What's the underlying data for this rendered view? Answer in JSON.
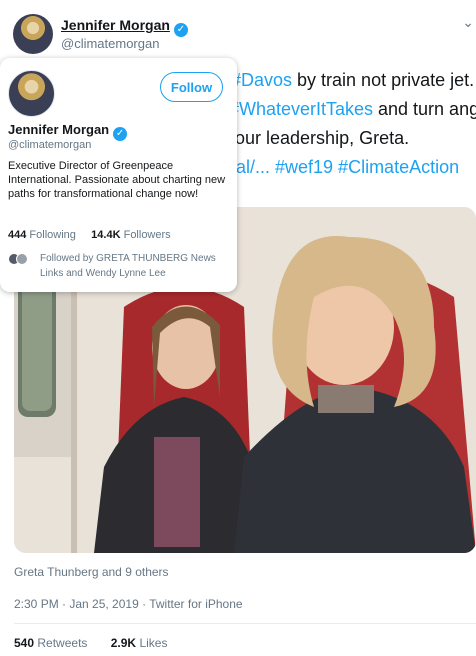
{
  "tweet": {
    "author_name": "Jennifer Morgan",
    "author_handle": "@climatemorgan",
    "text_lines": [
      [
        "",
        "#Davos",
        " by train not private jet."
      ],
      [
        "",
        "#WhateverItTakes",
        " and turn anger"
      ],
      [
        "our leadership, Greta.",
        "",
        ""
      ],
      [
        "",
        "al/... #wef19 #ClimateAction",
        ""
      ]
    ],
    "photo_tagged": "Greta Thunberg and 9 others",
    "timestamp": "2:30 PM · Jan 25, 2019 · Twitter for iPhone",
    "retweets_count": "540",
    "retweets_label": "Retweets",
    "likes_count": "2.9K",
    "likes_label": "Likes"
  },
  "hovercard": {
    "follow_label": "Follow",
    "name": "Jennifer Morgan",
    "handle": "@climatemorgan",
    "bio": "Executive Director of Greenpeace International. Passionate about charting new paths for transformational change now!",
    "following_count": "444",
    "following_label": "Following",
    "followers_count": "14.4K",
    "followers_label": "Followers",
    "followed_by": "Followed by GRETA THUNBERG News Links and Wendy Lynne Lee"
  },
  "icons": {
    "verified": "verified-badge-icon",
    "chevron": "chevron-down-icon"
  },
  "colors": {
    "link": "#1da1f2",
    "secondary_text": "#657786",
    "primary_text": "#14171a"
  }
}
